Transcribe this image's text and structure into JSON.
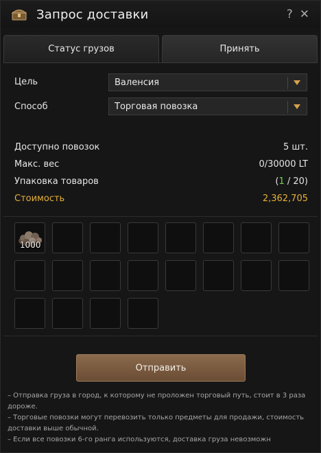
{
  "window": {
    "title": "Запрос доставки",
    "help_label": "?",
    "close_label": "✕"
  },
  "tabs": [
    {
      "label": "Статус грузов",
      "active": false
    },
    {
      "label": "Принять",
      "active": true
    }
  ],
  "form": {
    "destination_label": "Цель",
    "destination_value": "Валенсия",
    "method_label": "Способ",
    "method_value": "Торговая повозка"
  },
  "info": {
    "carriages_label": "Доступно повозок",
    "carriages_value": "5 шт.",
    "max_weight_label": "Макс. вес",
    "max_weight_value": "0/30000 LT",
    "packing_label": "Упаковка товаров",
    "packing_open": "(",
    "packing_used": "1",
    "packing_rest": " / 20)",
    "cost_label": "Стоимость",
    "cost_value": "2,362,705"
  },
  "slots": {
    "item": {
      "name_icon": "ore-pile-icon",
      "quantity": "1000"
    }
  },
  "send_button_label": "Отправить",
  "notes": [
    "– Отправка груза в город, к которому не проложен торговый путь, стоит в 3 раза дороже.",
    "– Торговые повозки могут перевозить только предметы для продажи, стоимость доставки выше обычной.",
    "– Если все повозки 6-го ранга используются, доставка груза невозможн"
  ],
  "colors": {
    "accent_gold": "#e7b13a",
    "highlight_green": "#6fd64d",
    "button_brown": "#7a5a3f"
  }
}
